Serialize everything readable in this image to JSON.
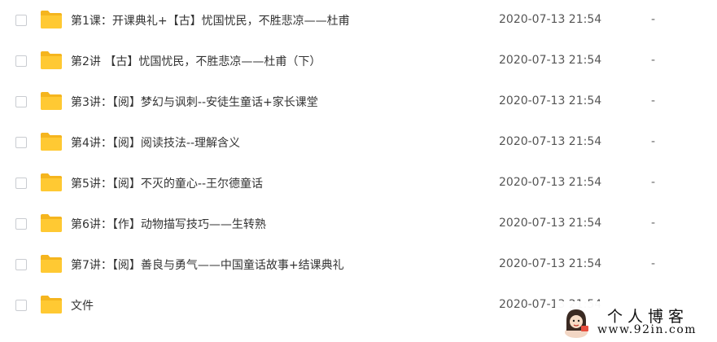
{
  "files": [
    {
      "name": "第1课：开课典礼+【古】忧国忧民，不胜悲凉——杜甫",
      "modified": "2020-07-13 21:54",
      "size": "-",
      "icon": "folder-icon"
    },
    {
      "name": "第2讲 【古】忧国忧民，不胜悲凉——杜甫（下）",
      "modified": "2020-07-13 21:54",
      "size": "-",
      "icon": "folder-icon"
    },
    {
      "name": "第3讲：【阅】梦幻与讽刺--安徒生童话+家长课堂",
      "modified": "2020-07-13 21:54",
      "size": "-",
      "icon": "folder-icon"
    },
    {
      "name": "第4讲：【阅】阅读技法--理解含义",
      "modified": "2020-07-13 21:54",
      "size": "-",
      "icon": "folder-icon"
    },
    {
      "name": "第5讲：【阅】不灭的童心--王尔德童话",
      "modified": "2020-07-13 21:54",
      "size": "-",
      "icon": "folder-icon"
    },
    {
      "name": "第6讲：【作】动物描写技巧——生转熟",
      "modified": "2020-07-13 21:54",
      "size": "-",
      "icon": "folder-icon"
    },
    {
      "name": "第7讲：【阅】善良与勇气——中国童话故事+结课典礼",
      "modified": "2020-07-13 21:54",
      "size": "-",
      "icon": "folder-icon"
    },
    {
      "name": "文件",
      "modified": "2020-07-13 21:54",
      "size": "",
      "icon": "folder-icon"
    }
  ],
  "watermark": {
    "title": "个人博客",
    "url": "www.92in.com"
  },
  "colors": {
    "folder": "#ffc933",
    "folder_tab": "#f5b51e",
    "text": "#333333",
    "date": "#555555",
    "checkbox_border": "#c9ccd1"
  }
}
